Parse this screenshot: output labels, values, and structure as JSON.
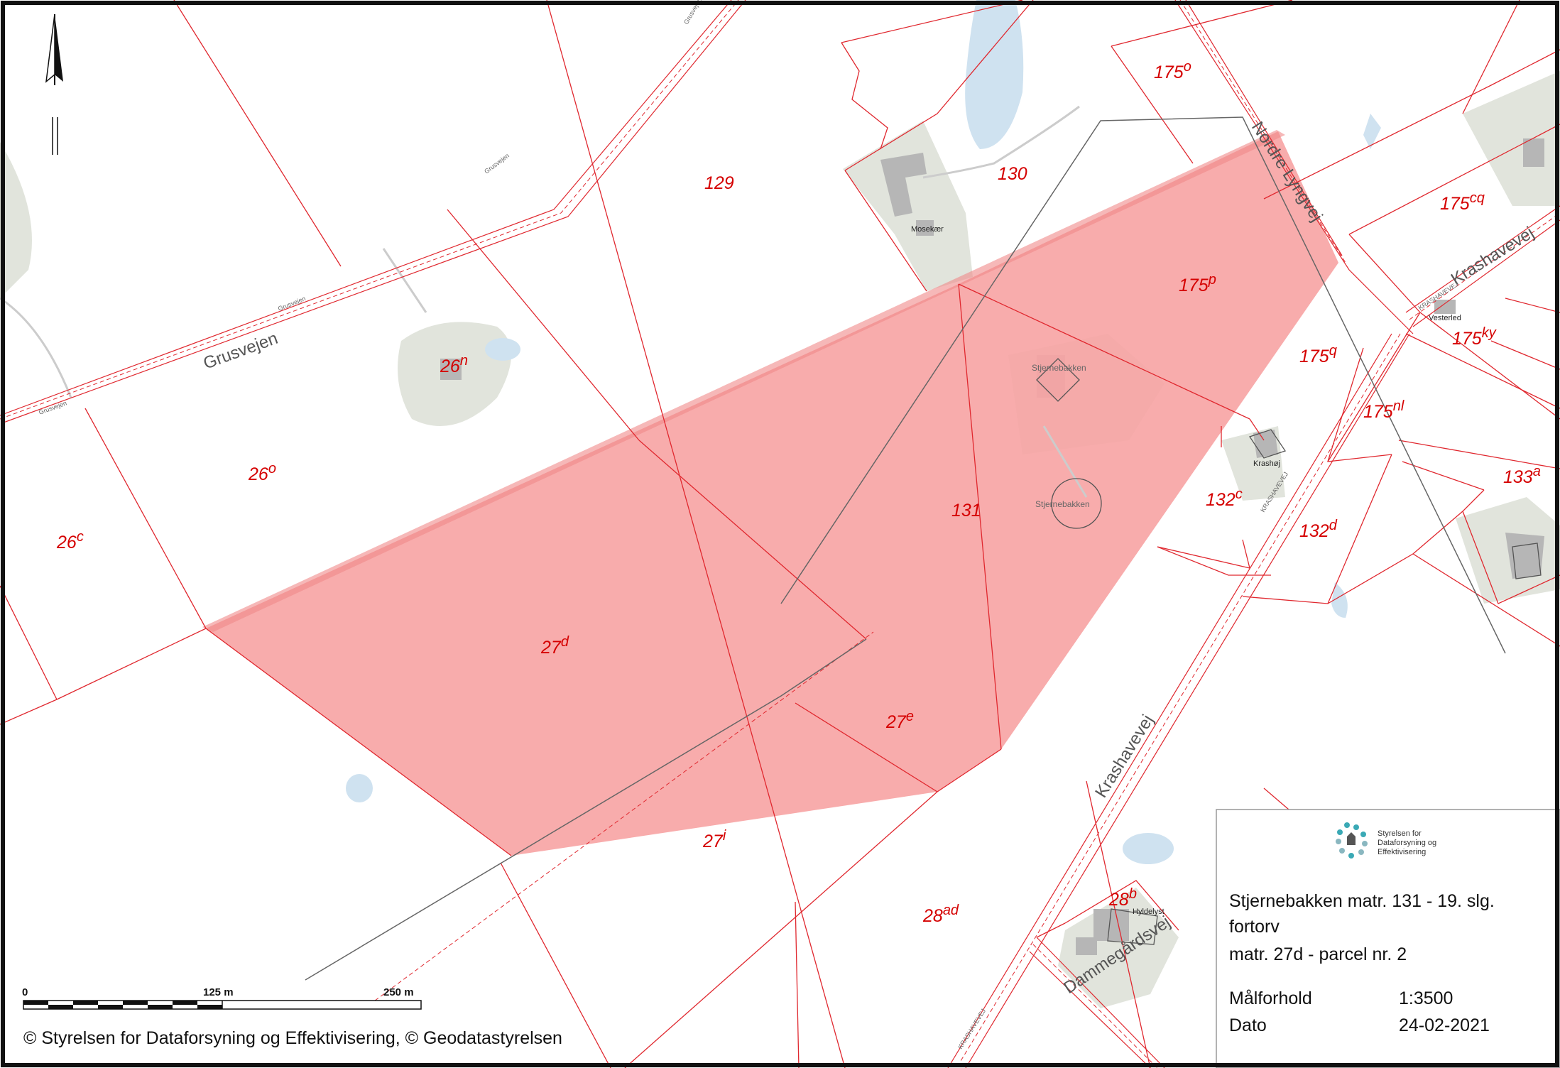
{
  "map": {
    "parcels": [
      {
        "base": "129",
        "sup": ""
      },
      {
        "base": "130",
        "sup": ""
      },
      {
        "base": "175",
        "sup": "o"
      },
      {
        "base": "175",
        "sup": "cq"
      },
      {
        "base": "175",
        "sup": "p"
      },
      {
        "base": "175",
        "sup": "q"
      },
      {
        "base": "175",
        "sup": "ky"
      },
      {
        "base": "175",
        "sup": "nl"
      },
      {
        "base": "133",
        "sup": "a"
      },
      {
        "base": "26",
        "sup": "n"
      },
      {
        "base": "26",
        "sup": "o"
      },
      {
        "base": "26",
        "sup": "c"
      },
      {
        "base": "131",
        "sup": ""
      },
      {
        "base": "132",
        "sup": "c"
      },
      {
        "base": "132",
        "sup": "d"
      },
      {
        "base": "27",
        "sup": "d"
      },
      {
        "base": "27",
        "sup": "e"
      },
      {
        "base": "27",
        "sup": "i"
      },
      {
        "base": "28",
        "sup": "ad"
      },
      {
        "base": "28",
        "sup": "b"
      }
    ],
    "roads": {
      "grusvejen_large": "Grusvejen",
      "grusvejen_small_1": "Grusvejen",
      "grusvejen_small_2": "Grusvejen",
      "grusvejen_small_3": "Grusvejen",
      "grusvejen_small_4": "Grusvejen",
      "nordre_lyngvej": "Nordre Lyngvej",
      "krashavevej_ne": "Krashavevej",
      "krashavevej_ne_small": "KRASHAVEVEJ",
      "krashavevej_mid_small": "KRASHAVEVEJ",
      "krashavevej_large": "Krashavevej",
      "krashavevej_bottom_small": "KRASHAVEVEJ",
      "dammegardsvej": "Dammegårdsvej"
    },
    "places": {
      "mosekaer": "Mosekær",
      "stjernebakken_house": "Stjernebakken",
      "stjernebakken_hill": "Stjernebakken",
      "krashoj": "Krashøj",
      "vesterled": "Vesterled",
      "hyldelyst": "Hyldelyst"
    },
    "colors": {
      "highlight_fill": "#f7a3a3",
      "boundary": "#e0282f",
      "water": "#cfe2f0",
      "built_area": "#e1e4dc",
      "building": "#b6b6b6"
    }
  },
  "north_arrow": {
    "icon": "north-arrow-icon"
  },
  "scale_bar": {
    "label_0": "0",
    "label_mid": "125 m",
    "label_end": "250 m"
  },
  "copyright": "© Styrelsen for Dataforsyning og Effektivisering, © Geodatastyrelsen",
  "info": {
    "logo": {
      "line1": "Styrelsen for",
      "line2": "Dataforsyning og",
      "line3": "Effektivisering"
    },
    "title_line1": "Stjernebakken matr. 131 - 19. slg.",
    "title_line2": "fortorv",
    "title_line3": "matr. 27d - parcel nr. 2",
    "scale_label": "Målforhold",
    "scale_value": "1:3500",
    "date_label": "Dato",
    "date_value": "24-02-2021"
  }
}
